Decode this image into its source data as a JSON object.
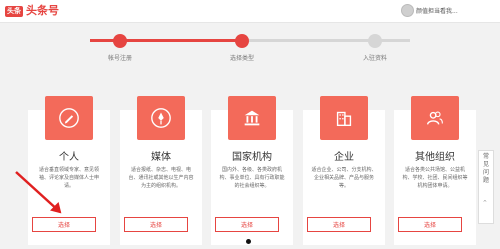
{
  "header": {
    "logo_badge": "头条",
    "logo_text": "头条号",
    "username": "颜值担当看我..."
  },
  "steps": [
    {
      "label": "帐号注册",
      "state": "done"
    },
    {
      "label": "选择类型",
      "state": "current"
    },
    {
      "label": "入驻资料",
      "state": "todo"
    }
  ],
  "cards": [
    {
      "icon": "pen-icon",
      "title": "个人",
      "desc": "适合垂直领域专家、意见领袖、评论家及自媒体人士申请。",
      "button": "选择"
    },
    {
      "icon": "pen-nib-icon",
      "title": "媒体",
      "desc": "适合报纸、杂志、电视、电台、通讯社或其他以生产内容为主的组织机构。",
      "button": "选择"
    },
    {
      "icon": "bank-icon",
      "title": "国家机构",
      "desc": "国内外、各级、各类政府机构、事业单位、具有行政职能的社会组织等。",
      "button": "选择"
    },
    {
      "icon": "building-icon",
      "title": "企业",
      "desc": "适合企业、公司、分支机构、企业相关品牌、产品与服务等。",
      "button": "选择"
    },
    {
      "icon": "people-icon",
      "title": "其他组织",
      "desc": "适合各类公共场馆、公益机构、学校、社团、民间组织等机构团体申请。",
      "button": "选择"
    }
  ],
  "side_widget": {
    "label": "常见问题",
    "up": "⌃"
  },
  "colors": {
    "accent": "#e64541",
    "icon_bg": "#f36a5a"
  }
}
